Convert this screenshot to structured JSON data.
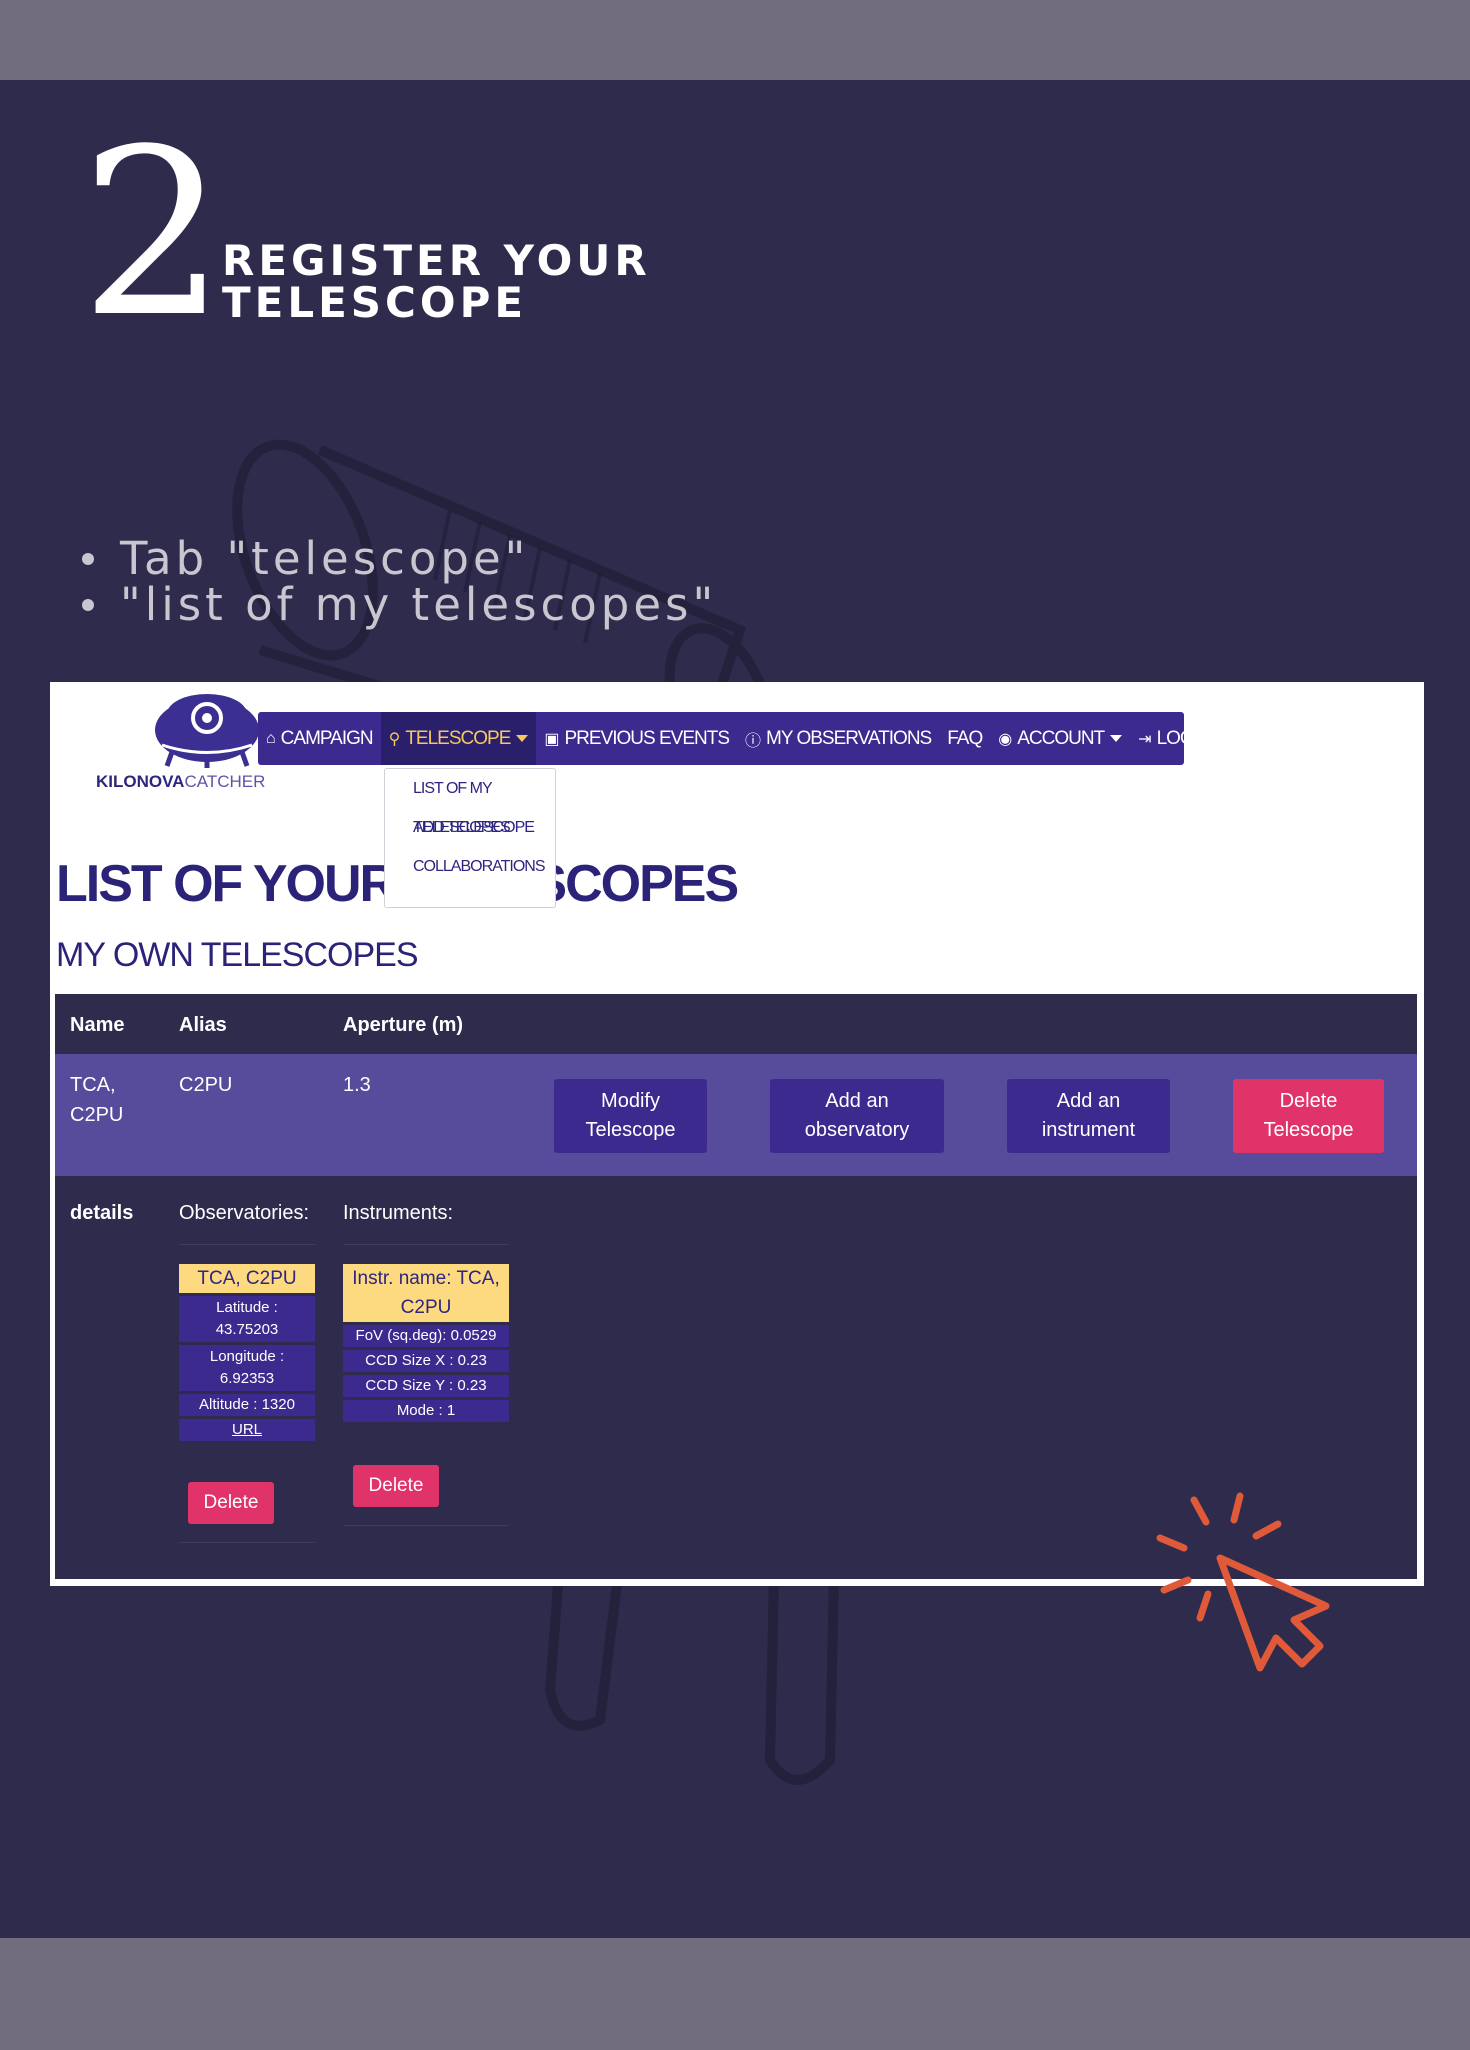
{
  "slide": {
    "step_number": "2",
    "title_line1": "REGISTER YOUR",
    "title_line2": "TELESCOPE",
    "bullets": [
      "Tab \"telescope\"",
      "\"list of my telescopes\""
    ]
  },
  "app": {
    "logo_text_bold": "KILONOVA",
    "logo_text_light": "CATCHER",
    "nav": [
      {
        "label": "CAMPAIGN",
        "icon": "home-icon"
      },
      {
        "label": "TELESCOPE",
        "icon": "telescope-icon"
      },
      {
        "label": "PREVIOUS EVENTS",
        "icon": "calendar-icon"
      },
      {
        "label": "MY OBSERVATIONS",
        "icon": "info-icon"
      },
      {
        "label": "FAQ",
        "icon": ""
      },
      {
        "label": "ACCOUNT",
        "icon": "user-icon"
      },
      {
        "label": "LOGOUT",
        "icon": "logout-icon"
      }
    ],
    "dropdown": [
      "LIST OF MY TELESCOPES",
      "ADD TELESCOPE",
      "COLLABORATIONS"
    ],
    "page_heading": "LIST OF YOUR TELESCOPES",
    "sub_heading": "MY OWN TELESCOPES",
    "table": {
      "headers": [
        "Name",
        "Alias",
        "Aperture (m)"
      ],
      "row": {
        "name": "TCA, C2PU",
        "alias": "C2PU",
        "aperture": "1.3",
        "buttons": [
          "Modify Telescope",
          "Add an observatory",
          "Add an instrument",
          "Delete Telescope"
        ]
      },
      "details_label": "details",
      "observatories_label": "Observatories:",
      "instruments_label": "Instruments:",
      "observatory": {
        "name": "TCA, C2PU",
        "latitude": "Latitude : 43.75203",
        "longitude": "Longitude : 6.92353",
        "altitude": "Altitude : 1320",
        "url": "URL",
        "delete": "Delete"
      },
      "instrument": {
        "name": "Instr. name: TCA, C2PU",
        "fov": "FoV (sq.deg): 0.0529",
        "ccd_x": "CCD Size X : 0.23",
        "ccd_y": "CCD Size Y : 0.23",
        "mode": "Mode : 1",
        "delete": "Delete"
      }
    }
  },
  "colors": {
    "background": "#2e2b4d",
    "band": "#726d7e",
    "nav": "#3d2a8e",
    "active": "#f6c85f",
    "danger": "#e0336a",
    "highlight": "#fdd97f",
    "cursor": "#e05a3a"
  }
}
